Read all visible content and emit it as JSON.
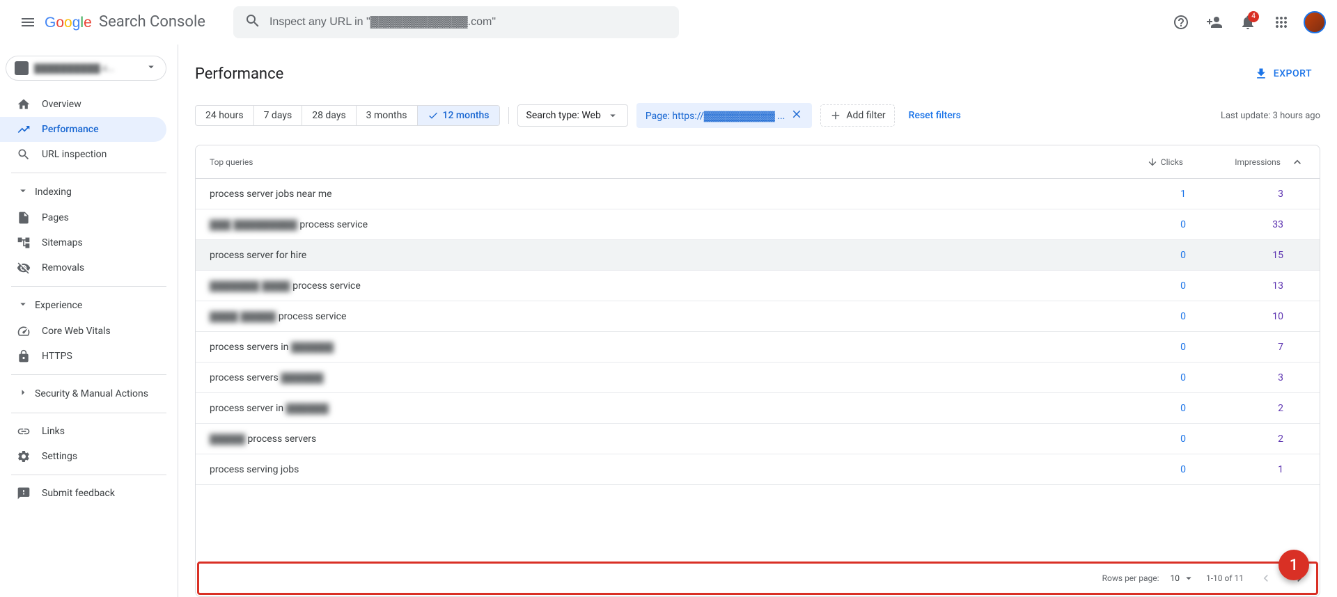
{
  "header": {
    "logo_text": "Search Console",
    "search_placeholder": "Inspect any URL in \"▓▓▓▓▓▓▓▓▓▓▓▓.com\"",
    "notification_count": "4"
  },
  "sidebar": {
    "property_text": "▓▓▓▓▓▓▓▓▓▓.c...",
    "nav_overview": "Overview",
    "nav_performance": "Performance",
    "nav_url_inspection": "URL inspection",
    "section_indexing": "Indexing",
    "nav_pages": "Pages",
    "nav_sitemaps": "Sitemaps",
    "nav_removals": "Removals",
    "section_experience": "Experience",
    "nav_cwv": "Core Web Vitals",
    "nav_https": "HTTPS",
    "section_security": "Security & Manual Actions",
    "nav_links": "Links",
    "nav_settings": "Settings",
    "nav_feedback": "Submit feedback"
  },
  "page": {
    "title": "Performance",
    "export": "EXPORT",
    "last_update": "Last update: 3 hours ago"
  },
  "date_filters": {
    "h24": "24 hours",
    "d7": "7 days",
    "d28": "28 days",
    "m3": "3 months",
    "m12": "12 months"
  },
  "chips": {
    "search_type": "Search type: Web",
    "page_filter": "Page: https://▓▓▓▓▓▓▓▓▓▓ ...",
    "add_filter": "Add filter",
    "reset": "Reset filters"
  },
  "table": {
    "header_query": "Top queries",
    "header_clicks": "Clicks",
    "header_impressions": "Impressions",
    "rows": [
      {
        "query": "process server jobs near me",
        "clicks": "1",
        "impressions": "3",
        "blur": false,
        "highlighted": false
      },
      {
        "query": "▓▓▓ ▓▓▓▓▓▓▓▓▓ process service",
        "clicks": "0",
        "impressions": "33",
        "blur": true,
        "highlighted": false
      },
      {
        "query": "process server for hire",
        "clicks": "0",
        "impressions": "15",
        "blur": false,
        "highlighted": true
      },
      {
        "query": "▓▓▓▓▓▓▓ ▓▓▓▓ process service",
        "clicks": "0",
        "impressions": "13",
        "blur": true,
        "highlighted": false
      },
      {
        "query": "▓▓▓▓ ▓▓▓▓▓ process service",
        "clicks": "0",
        "impressions": "10",
        "blur": true,
        "highlighted": false
      },
      {
        "query": "process servers in ▓▓▓▓▓▓",
        "clicks": "0",
        "impressions": "7",
        "blur": true,
        "highlighted": false
      },
      {
        "query": "process servers ▓▓▓▓▓▓",
        "clicks": "0",
        "impressions": "3",
        "blur": true,
        "highlighted": false
      },
      {
        "query": "process server in ▓▓▓▓▓▓",
        "clicks": "0",
        "impressions": "2",
        "blur": true,
        "highlighted": false
      },
      {
        "query": "▓▓▓▓▓ process servers",
        "clicks": "0",
        "impressions": "2",
        "blur": true,
        "highlighted": false
      },
      {
        "query": "process serving jobs",
        "clicks": "0",
        "impressions": "1",
        "blur": false,
        "highlighted": false
      }
    ],
    "footer": {
      "rows_per_page_label": "Rows per page:",
      "rows_per_page_value": "10",
      "range": "1-10 of 11"
    }
  },
  "fab": "1"
}
